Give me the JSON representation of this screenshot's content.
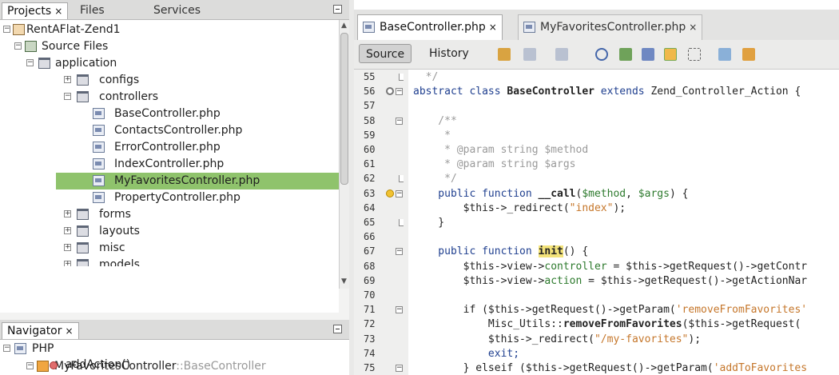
{
  "left_panel": {
    "tabs": [
      {
        "label": "Projects",
        "close": "×"
      },
      {
        "label": "Files"
      },
      {
        "label": "Services"
      }
    ],
    "tree": [
      {
        "label": "RentAFlat-Zend1",
        "depth": 0,
        "icon": "project-icon",
        "expander": "−"
      },
      {
        "label": "Source Files",
        "depth": 1,
        "icon": "source-files-icon",
        "expander": "−"
      },
      {
        "label": "application",
        "depth": 2,
        "icon": "folder-open-icon",
        "expander": "−"
      },
      {
        "label": "configs",
        "depth": 3,
        "icon": "folder-icon",
        "expander": "+"
      },
      {
        "label": "controllers",
        "depth": 3,
        "icon": "folder-open-icon",
        "expander": "−"
      },
      {
        "label": "BaseController.php",
        "depth": 4,
        "icon": "php-file-icon"
      },
      {
        "label": "ContactsController.php",
        "depth": 4,
        "icon": "php-file-icon"
      },
      {
        "label": "ErrorController.php",
        "depth": 4,
        "icon": "php-file-icon"
      },
      {
        "label": "IndexController.php",
        "depth": 4,
        "icon": "php-file-icon"
      },
      {
        "label": "MyFavoritesController.php",
        "depth": 4,
        "icon": "php-file-icon",
        "selected": true
      },
      {
        "label": "PropertyController.php",
        "depth": 4,
        "icon": "php-file-icon"
      },
      {
        "label": "forms",
        "depth": 3,
        "icon": "folder-icon",
        "expander": "+"
      },
      {
        "label": "layouts",
        "depth": 3,
        "icon": "folder-icon",
        "expander": "+"
      },
      {
        "label": "misc",
        "depth": 3,
        "icon": "folder-icon",
        "expander": "+"
      },
      {
        "label": "models",
        "depth": 3,
        "icon": "folder-icon",
        "expander": "+"
      }
    ]
  },
  "navigator": {
    "tab": {
      "label": "Navigator",
      "close": "×"
    },
    "items": [
      {
        "label": "PHP",
        "icon": "php-file-icon",
        "expander": "−"
      },
      {
        "label": "MyFavoritesController",
        "suffix": "::BaseController",
        "icon": "class-icon",
        "expander": "−"
      },
      {
        "label": "addAction()",
        "icon": "method-icon"
      }
    ]
  },
  "editor": {
    "tabs": [
      {
        "label": "BaseController.php",
        "close": "×",
        "active": true
      },
      {
        "label": "MyFavoritesController.php",
        "close": "×"
      }
    ],
    "source_label": "Source",
    "history_label": "History",
    "line_numbers": [
      "55",
      "56",
      "57",
      "58",
      "59",
      "60",
      "61",
      "62",
      "63",
      "64",
      "65",
      "66",
      "67",
      "68",
      "69",
      "70",
      "71",
      "72",
      "73",
      "74",
      "75"
    ],
    "code": [
      {
        "n": "55",
        "segs": [
          {
            "t": "  */",
            "c": "cm"
          }
        ]
      },
      {
        "n": "56",
        "segs": [
          {
            "t": "abstract class ",
            "c": "kw"
          },
          {
            "t": "BaseController",
            "c": "bold"
          },
          {
            "t": " extends ",
            "c": "kw"
          },
          {
            "t": "Zend_Controller_Action {"
          }
        ]
      },
      {
        "n": "57",
        "segs": [
          {
            "t": ""
          }
        ]
      },
      {
        "n": "58",
        "segs": [
          {
            "t": "    /**",
            "c": "cm"
          }
        ]
      },
      {
        "n": "59",
        "segs": [
          {
            "t": "     *",
            "c": "cm"
          }
        ]
      },
      {
        "n": "60",
        "segs": [
          {
            "t": "     * @param string $method",
            "c": "cm"
          }
        ]
      },
      {
        "n": "61",
        "segs": [
          {
            "t": "     * @param string $args",
            "c": "cm"
          }
        ]
      },
      {
        "n": "62",
        "segs": [
          {
            "t": "     */",
            "c": "cm"
          }
        ]
      },
      {
        "n": "63",
        "segs": [
          {
            "t": "    public function ",
            "c": "kw"
          },
          {
            "t": "__call",
            "c": "bold"
          },
          {
            "t": "("
          },
          {
            "t": "$method",
            "c": "var"
          },
          {
            "t": ", "
          },
          {
            "t": "$args",
            "c": "var"
          },
          {
            "t": ") {"
          }
        ]
      },
      {
        "n": "64",
        "segs": [
          {
            "t": "        $this->_redirect("
          },
          {
            "t": "\"index\"",
            "c": "str"
          },
          {
            "t": ");"
          }
        ]
      },
      {
        "n": "65",
        "segs": [
          {
            "t": "    }"
          }
        ]
      },
      {
        "n": "66",
        "segs": [
          {
            "t": ""
          }
        ]
      },
      {
        "n": "67",
        "segs": [
          {
            "t": "    public function ",
            "c": "kw"
          },
          {
            "t": "init",
            "c": "bold hl"
          },
          {
            "t": "() {"
          }
        ]
      },
      {
        "n": "68",
        "segs": [
          {
            "t": "        $this->view->"
          },
          {
            "t": "controller",
            "c": "var"
          },
          {
            "t": " = $this->getRequest()->getContr"
          }
        ]
      },
      {
        "n": "69",
        "segs": [
          {
            "t": "        $this->view->"
          },
          {
            "t": "action",
            "c": "var"
          },
          {
            "t": " = $this->getRequest()->getActionNar"
          }
        ]
      },
      {
        "n": "70",
        "segs": [
          {
            "t": ""
          }
        ]
      },
      {
        "n": "71",
        "segs": [
          {
            "t": "        if ($this->getRequest()->getParam("
          },
          {
            "t": "'removeFromFavorites'",
            "c": "str"
          }
        ]
      },
      {
        "n": "72",
        "segs": [
          {
            "t": "            Misc_Utils::"
          },
          {
            "t": "removeFromFavorites",
            "c": "bold"
          },
          {
            "t": "($this->getRequest("
          }
        ]
      },
      {
        "n": "73",
        "segs": [
          {
            "t": "            $this->_redirect("
          },
          {
            "t": "\"/my-favorites\"",
            "c": "str"
          },
          {
            "t": ");"
          }
        ]
      },
      {
        "n": "74",
        "segs": [
          {
            "t": "            exit;",
            "c": "kw"
          }
        ]
      },
      {
        "n": "75",
        "segs": [
          {
            "t": "        } elseif ($this->getRequest()->getParam("
          },
          {
            "t": "'addToFavorites",
            "c": "str"
          }
        ]
      }
    ]
  }
}
